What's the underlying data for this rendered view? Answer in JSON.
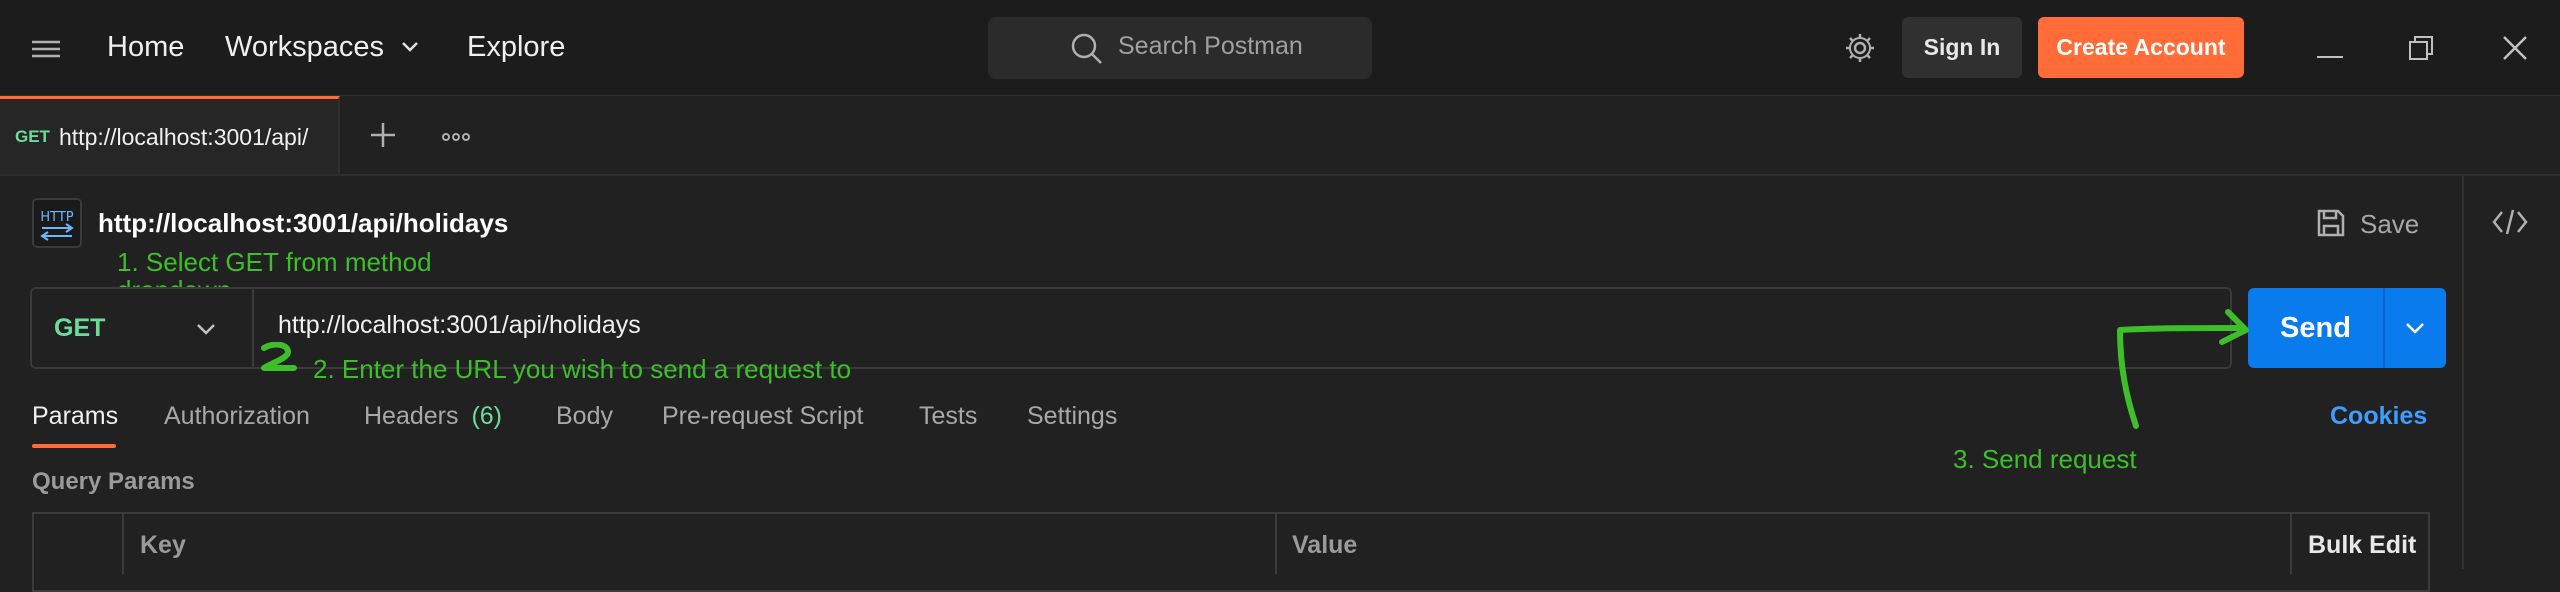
{
  "topbar": {
    "nav": {
      "home": "Home",
      "workspaces": "Workspaces",
      "explore": "Explore"
    },
    "search_placeholder": "Search Postman",
    "sign_in": "Sign In",
    "create_account": "Create Account"
  },
  "tab": {
    "method": "GET",
    "url": "http://localhost:3001/api/"
  },
  "request": {
    "title": "http://localhost:3001/api/holidays",
    "save": "Save",
    "method": "GET",
    "url": "http://localhost:3001/api/holidays",
    "send": "Send"
  },
  "request_tabs": {
    "params": "Params",
    "authorization": "Authorization",
    "headers": "Headers",
    "headers_count": "(6)",
    "body": "Body",
    "prerequest": "Pre-request Script",
    "tests": "Tests",
    "settings": "Settings",
    "cookies": "Cookies"
  },
  "query_params": {
    "heading": "Query Params",
    "columns": {
      "key": "Key",
      "value": "Value",
      "bulk_edit": "Bulk Edit"
    }
  },
  "annotations": {
    "step1_line1": "1. Select GET from method",
    "step1_line2": "dropdown",
    "step2": "2. Enter the URL you wish to send a request to",
    "step3": "3. Send request",
    "color": "#3dbf2a"
  },
  "colors": {
    "accent": "#ff6c37",
    "send": "#097bed",
    "method_get": "#6bdd9a",
    "link": "#3e9dff"
  }
}
